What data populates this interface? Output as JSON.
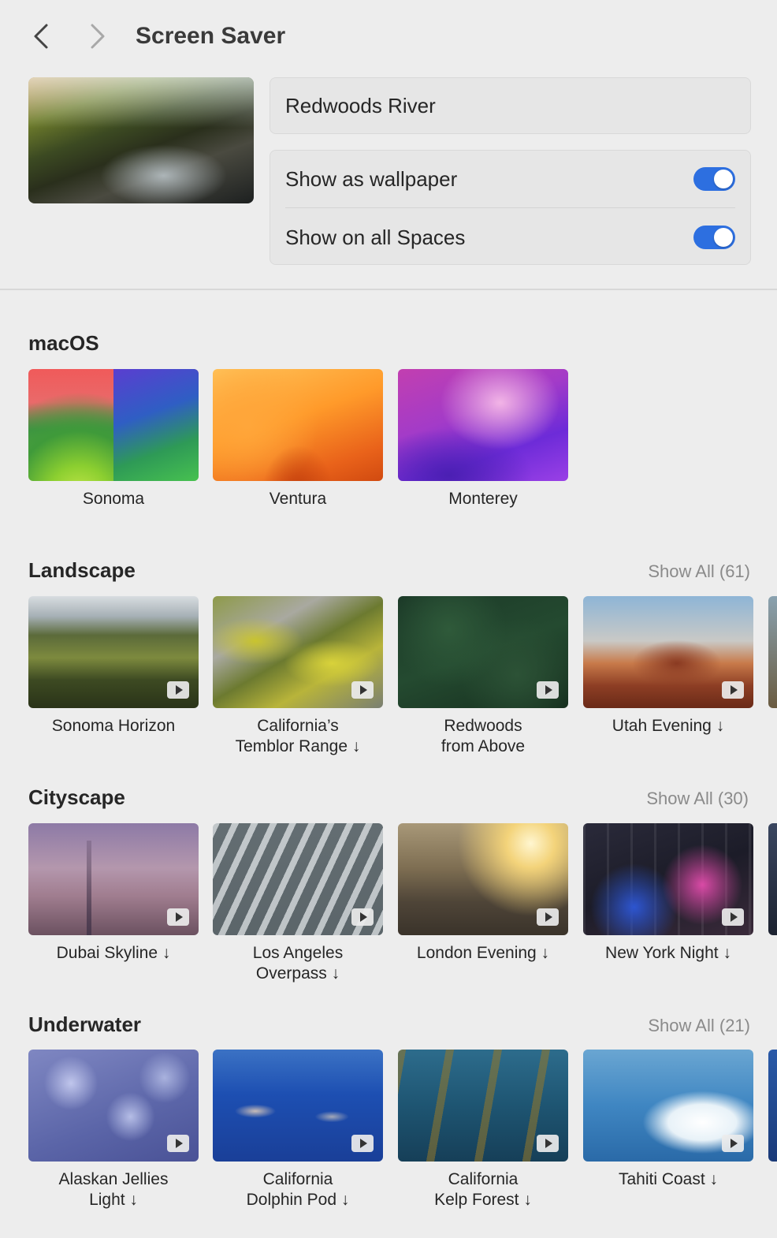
{
  "header": {
    "title": "Screen Saver",
    "back_icon": "chevron-left-icon",
    "forward_icon": "chevron-right-icon"
  },
  "current": {
    "name": "Redwoods River",
    "options": [
      {
        "label": "Show as wallpaper",
        "enabled": true
      },
      {
        "label": "Show on all Spaces",
        "enabled": true
      }
    ]
  },
  "colors": {
    "accent": "#2d6fe0",
    "background": "#ededed"
  },
  "sections": {
    "macos": {
      "title": "macOS",
      "items": [
        {
          "line1": "Sonoma",
          "line2": ""
        },
        {
          "line1": "Ventura",
          "line2": ""
        },
        {
          "line1": "Monterey",
          "line2": ""
        }
      ]
    },
    "landscape": {
      "title": "Landscape",
      "show_all": "Show All (61)",
      "items": [
        {
          "line1": "Sonoma Horizon",
          "line2": ""
        },
        {
          "line1": "California’s",
          "line2": "Temblor Range ↓"
        },
        {
          "line1": "Redwoods",
          "line2": "from Above"
        },
        {
          "line1": "Utah Evening ↓",
          "line2": ""
        }
      ]
    },
    "cityscape": {
      "title": "Cityscape",
      "show_all": "Show All (30)",
      "items": [
        {
          "line1": "Dubai Skyline ↓",
          "line2": ""
        },
        {
          "line1": "Los Angeles",
          "line2": "Overpass ↓"
        },
        {
          "line1": "London Evening ↓",
          "line2": ""
        },
        {
          "line1": "New York Night ↓",
          "line2": ""
        }
      ]
    },
    "underwater": {
      "title": "Underwater",
      "show_all": "Show All (21)",
      "items": [
        {
          "line1": "Alaskan Jellies",
          "line2": "Light ↓"
        },
        {
          "line1": "California",
          "line2": "Dolphin Pod ↓"
        },
        {
          "line1": "California",
          "line2": "Kelp Forest ↓"
        },
        {
          "line1": "Tahiti Coast ↓",
          "line2": ""
        }
      ]
    }
  }
}
